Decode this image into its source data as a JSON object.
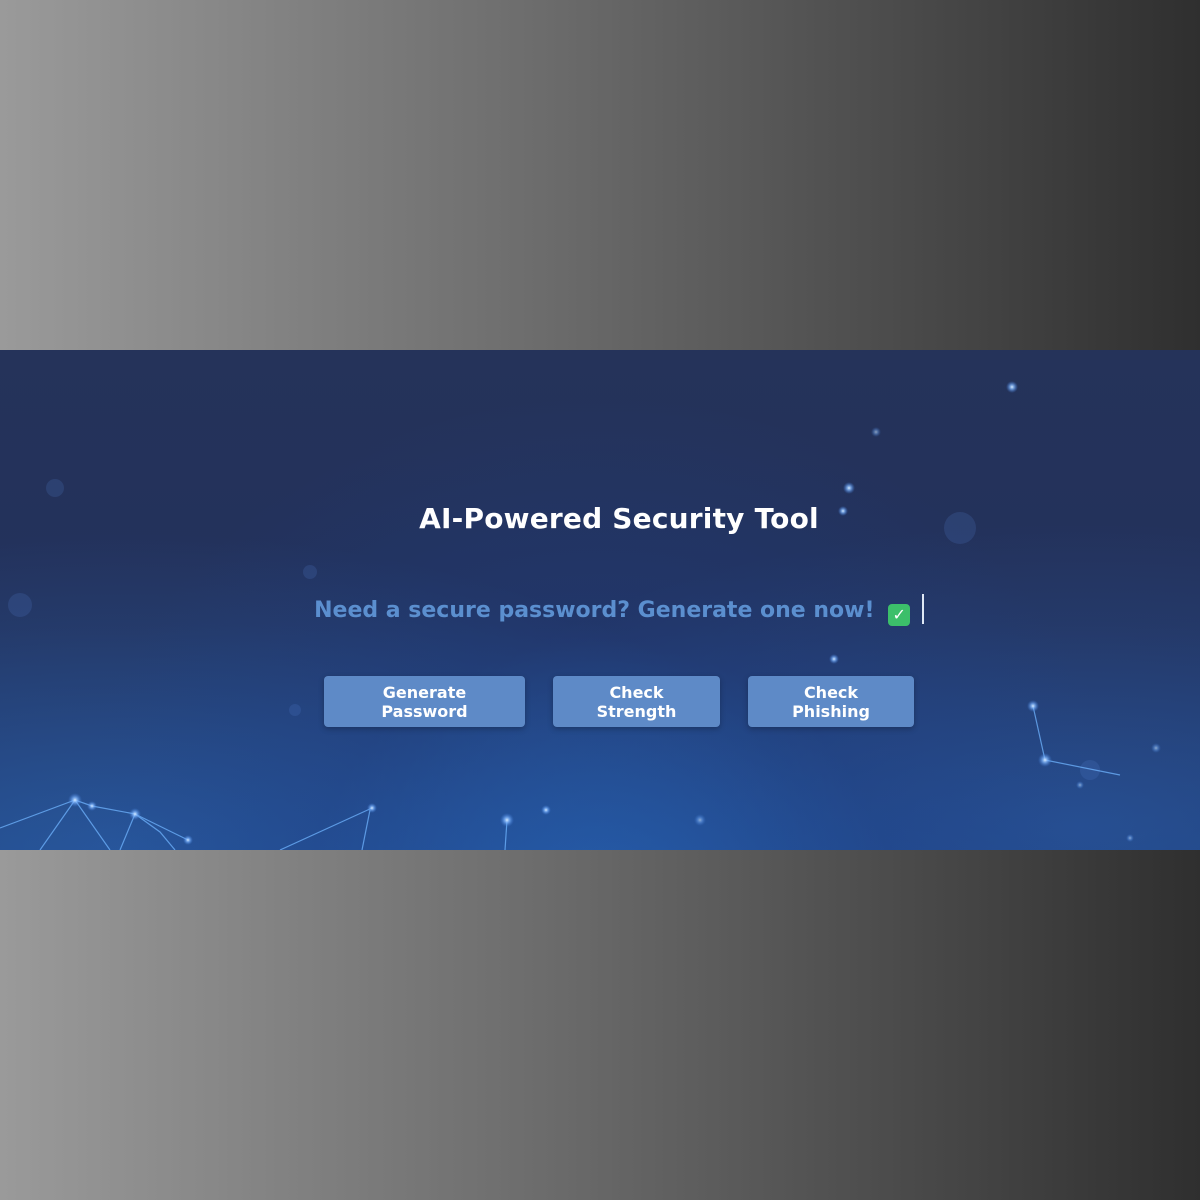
{
  "banner": {
    "title": "AI-Powered Security Tool",
    "tagline": "Need a secure password? Generate one now!",
    "tagline_icon": "check-mark-icon",
    "tagline_icon_glyph": "✓",
    "accent_color": "#5e8ac7",
    "tagline_color": "#5b8fcf",
    "background_color": "#25335a"
  },
  "actions": {
    "generate_label": "Generate Password",
    "strength_label": "Check Strength",
    "phishing_label": "Check Phishing"
  }
}
